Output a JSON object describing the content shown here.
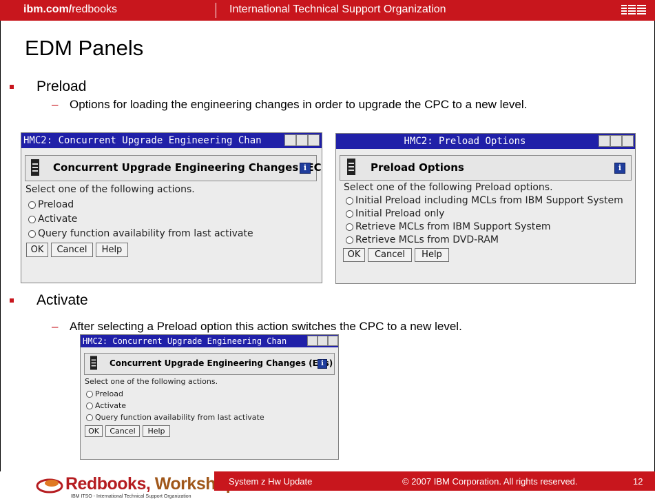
{
  "header": {
    "site_bold": "ibm.com/",
    "site_rest": "redbooks",
    "org": "International Technical Support Organization",
    "brand_color": "#c8161d"
  },
  "slide_title": "EDM Panels",
  "sections": [
    {
      "heading": "Preload",
      "dash": "–",
      "description": "Options for loading the engineering changes in order to upgrade the CPC to a new level."
    },
    {
      "heading": "Activate",
      "dash": "–",
      "description": "After selecting a Preload option this action switches the CPC to a new level."
    }
  ],
  "windows": {
    "upgrade_preload": {
      "title": "HMC2: Concurrent Upgrade Engineering Chan",
      "header": "Concurrent Upgrade Engineering Changes (ECs)",
      "info": "i",
      "prompt": "Select one of the following actions.",
      "options": [
        {
          "label": "Preload",
          "selected": true
        },
        {
          "label": "Activate",
          "selected": false
        },
        {
          "label": "Query function availability from last activate",
          "selected": false
        }
      ],
      "buttons": [
        "OK",
        "Cancel",
        "Help"
      ]
    },
    "preload_options": {
      "title": "HMC2: Preload Options",
      "header": "Preload Options",
      "info": "i",
      "prompt": "Select one of the following Preload options.",
      "options": [
        {
          "label": "Initial Preload including MCLs from IBM Support System",
          "selected": true
        },
        {
          "label": "Initial Preload only",
          "selected": false
        },
        {
          "label": "Retrieve MCLs from IBM Support System",
          "selected": false
        },
        {
          "label": "Retrieve MCLs from DVD-RAM",
          "selected": false
        }
      ],
      "buttons": [
        "OK",
        "Cancel",
        "Help"
      ]
    },
    "upgrade_activate": {
      "title": "HMC2: Concurrent Upgrade Engineering Chan",
      "header": "Concurrent Upgrade Engineering Changes (ECs)",
      "info": "i",
      "prompt": "Select one of the following actions.",
      "options": [
        {
          "label": "Preload",
          "selected": false
        },
        {
          "label": "Activate",
          "selected": true
        },
        {
          "label": "Query function availability from last activate",
          "selected": false
        }
      ],
      "buttons": [
        "OK",
        "Cancel",
        "Help"
      ]
    }
  },
  "footer": {
    "logo_word1": "Redbooks",
    "logo_word2": "Workshop",
    "logo_tagline": "IBM ITSO - International Technical Support Organization",
    "course": "System z Hw Update",
    "copyright": "© 2007 IBM Corporation. All rights reserved.",
    "page_number": "12"
  }
}
